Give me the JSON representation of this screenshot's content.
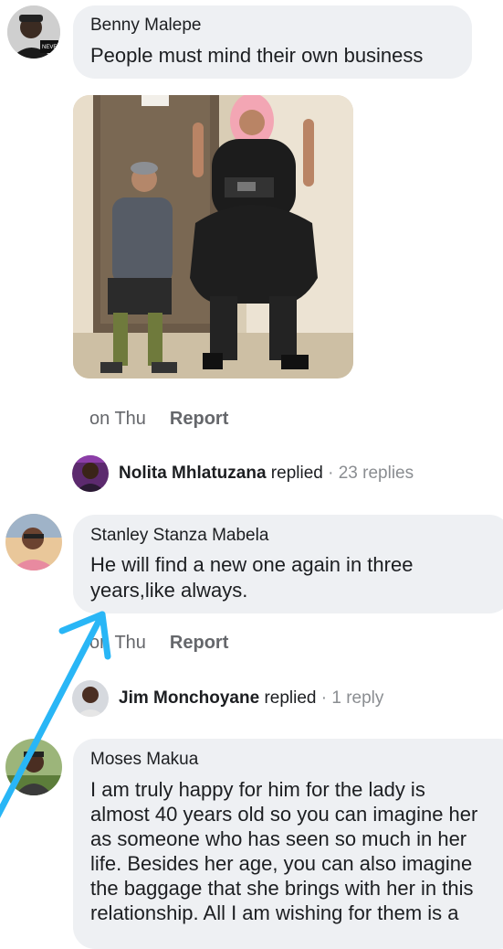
{
  "comments": [
    {
      "author": "Benny Malepe",
      "text": "People must mind their own business",
      "time": "on Thu",
      "report_label": "Report",
      "reply_preview": {
        "name": "Nolita Mhlatuzana",
        "verb": "replied",
        "sep": "·",
        "count": "23 replies"
      }
    },
    {
      "author": "Stanley Stanza Mabela",
      "text_lines": [
        "He will find a new one again in three",
        "years,like always."
      ],
      "time": "on Thu",
      "report_label": "Report",
      "reply_preview": {
        "name": "Jim Monchoyane",
        "verb": "replied",
        "sep": "·",
        "count": "1 reply"
      }
    },
    {
      "author": "Moses Makua",
      "text_lines": [
        "I am truly happy for him for the lady is",
        "almost 40 years old so you can imagine her",
        "as someone who has seen so much in her",
        "life. Besides her age, you can also imagine",
        "the baggage that she brings with her in this",
        "relationship. All I am wishing for them is a"
      ]
    }
  ],
  "annotation": {
    "arrow_color": "#29b6f6"
  },
  "colors": {
    "bubble": "#eef0f3",
    "meta": "#65676b"
  }
}
